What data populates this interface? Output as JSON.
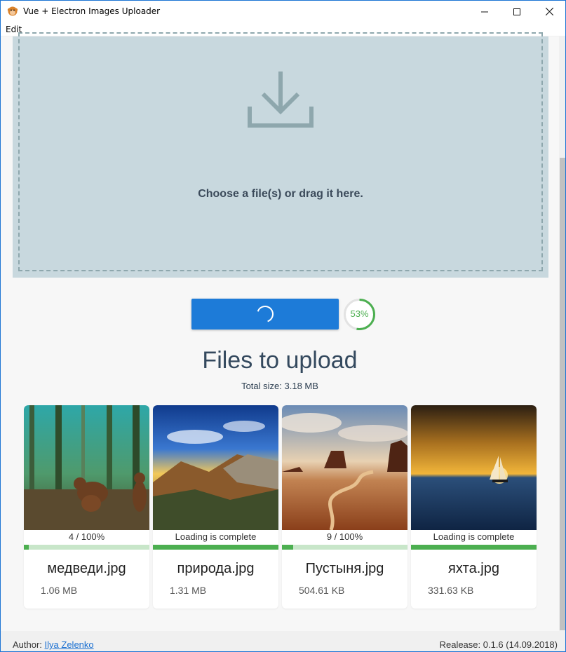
{
  "window": {
    "title": "Vue + Electron Images Uploader",
    "icon": "monkey-app-icon",
    "accent": "#1c74d4"
  },
  "menu": {
    "edit": "Edit"
  },
  "dropzone": {
    "icon": "download-tray-icon",
    "text": "Choose a file(s) or drag it here.",
    "background": "#c8d8de"
  },
  "upload": {
    "button_state": "loading",
    "progress_percent": 53,
    "progress_label": "53%",
    "button_color": "#1d7bd8",
    "progress_color": "#4caf50"
  },
  "files": {
    "title": "Files to upload",
    "total_size": "Total size: 3.18 MB",
    "items": [
      {
        "status": "4 / 100%",
        "progress": 0.04,
        "name": "медведи.jpg",
        "size": "1.06 MB",
        "image": "bears-in-forest"
      },
      {
        "status": "Loading is complete",
        "progress": 1.0,
        "name": "природа.jpg",
        "size": "1.31 MB",
        "image": "valley-landscape"
      },
      {
        "status": "9 / 100%",
        "progress": 0.09,
        "name": "Пустыня.jpg",
        "size": "504.61 KB",
        "image": "desert-monuments"
      },
      {
        "status": "Loading is complete",
        "progress": 1.0,
        "name": "яхта.jpg",
        "size": "331.63 KB",
        "image": "sailboat-sunset"
      }
    ]
  },
  "footer": {
    "author_label": "Author:",
    "author_name": "Ilya Zelenko",
    "release": "Realease: 0.1.6 (14.09.2018)"
  }
}
